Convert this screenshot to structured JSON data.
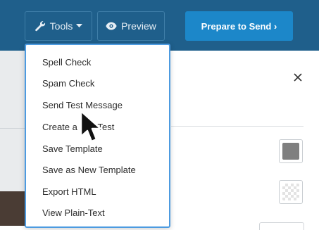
{
  "toolbar": {
    "tools_label": "Tools",
    "preview_label": "Preview",
    "send_label": "Prepare to Send ›",
    "background_color": "#1f5f8b",
    "send_color": "#1c87c9"
  },
  "tools_menu": {
    "items": [
      {
        "label": "Spell Check"
      },
      {
        "label": "Spam Check"
      },
      {
        "label": "Send Test Message"
      },
      {
        "label": "Create a S… Test"
      },
      {
        "label": "Save Template"
      },
      {
        "label": "Save as New Template"
      },
      {
        "label": "Export HTML"
      },
      {
        "label": "View Plain-Text"
      }
    ],
    "border_color": "#4d9be0"
  },
  "panel": {
    "close_symbol": "✕",
    "swatch_color": "#7f7f7f"
  },
  "icons": [
    "wrench-icon",
    "chevron-down-icon",
    "eye-icon",
    "close-icon",
    "mouse-pointer-icon",
    "transparent-pattern-icon"
  ]
}
